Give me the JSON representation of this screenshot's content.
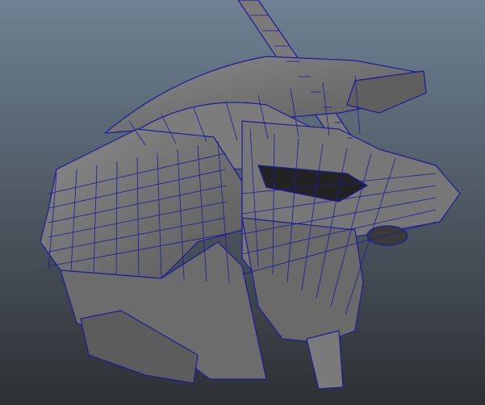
{
  "viewport": {
    "background_top": "#6f8193",
    "background_bottom": "#2d3033"
  },
  "model": {
    "surface_color": "#707070",
    "surface_light": "#8a8a8a",
    "surface_dark": "#3a3a3a",
    "wire_color": "#1c1c9a"
  }
}
